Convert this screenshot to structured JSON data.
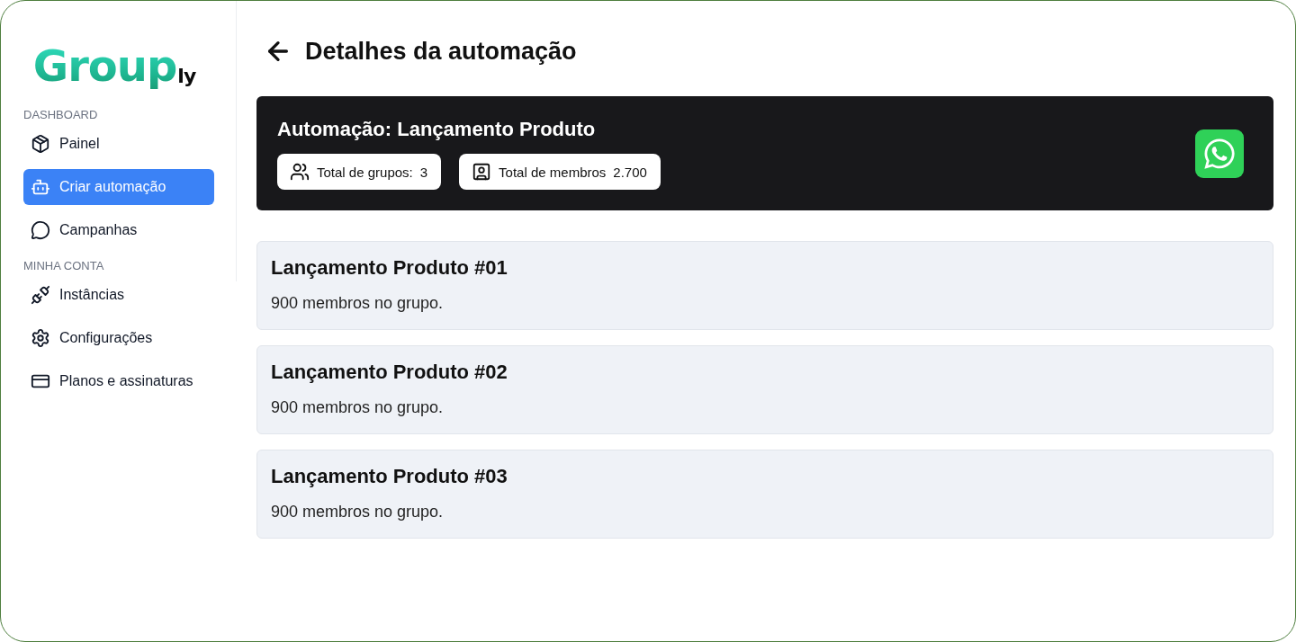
{
  "logo": {
    "text": "Group",
    "suffix": "ly"
  },
  "sidebar": {
    "sections": [
      {
        "heading": "DASHBOARD",
        "items": [
          {
            "label": "Painel",
            "selected": false
          },
          {
            "label": "Criar automação",
            "selected": true
          },
          {
            "label": "Campanhas",
            "selected": false
          }
        ]
      },
      {
        "heading": "MINHA CONTA",
        "items": [
          {
            "label": "Instâncias",
            "selected": false
          },
          {
            "label": "Configurações",
            "selected": false
          },
          {
            "label": "Planos e assinaturas",
            "selected": false
          }
        ]
      }
    ]
  },
  "page": {
    "title": "Detalhes da automação"
  },
  "summary": {
    "title": "Automação: Lançamento Produto",
    "stats": [
      {
        "label": "Total de grupos:",
        "value": "3"
      },
      {
        "label": "Total de membros",
        "value": "2.700"
      }
    ]
  },
  "groups": [
    {
      "name": "Lançamento Produto #01",
      "members": "900 membros no grupo."
    },
    {
      "name": "Lançamento Produto #02",
      "members": "900 membros no grupo."
    },
    {
      "name": "Lançamento Produto #03",
      "members": "900 membros no grupo."
    }
  ]
}
